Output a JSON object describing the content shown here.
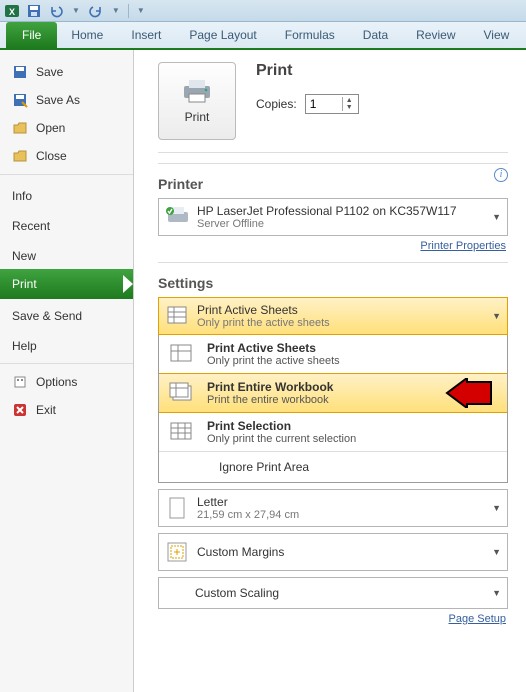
{
  "qat": {
    "undo_title": "Undo",
    "redo_title": "Redo"
  },
  "ribbon": {
    "file": "File",
    "tabs": [
      "Home",
      "Insert",
      "Page Layout",
      "Formulas",
      "Data",
      "Review",
      "View"
    ]
  },
  "sidebar": {
    "items": [
      {
        "label": "Save"
      },
      {
        "label": "Save As"
      },
      {
        "label": "Open"
      },
      {
        "label": "Close"
      }
    ],
    "cats": [
      {
        "label": "Info"
      },
      {
        "label": "Recent"
      },
      {
        "label": "New"
      },
      {
        "label": "Print"
      },
      {
        "label": "Save & Send"
      },
      {
        "label": "Help"
      }
    ],
    "footer": [
      {
        "label": "Options"
      },
      {
        "label": "Exit"
      }
    ]
  },
  "print": {
    "title": "Print",
    "button_label": "Print",
    "copies_label": "Copies:",
    "copies_value": "1"
  },
  "printer": {
    "section": "Printer",
    "name": "HP LaserJet Professional P1102 on KC357W117",
    "status": "Server Offline",
    "props_link": "Printer Properties"
  },
  "settings": {
    "section": "Settings",
    "selected": {
      "title": "Print Active Sheets",
      "sub": "Only print the active sheets"
    },
    "options": [
      {
        "title": "Print Active Sheets",
        "sub": "Only print the active sheets"
      },
      {
        "title": "Print Entire Workbook",
        "sub": "Print the entire workbook"
      },
      {
        "title": "Print Selection",
        "sub": "Only print the current selection"
      }
    ],
    "ignore": "Ignore Print Area",
    "paper": {
      "title": "Letter",
      "sub": "21,59 cm x 27,94 cm"
    },
    "margins": {
      "title": "Custom Margins"
    },
    "scaling": {
      "title": "Custom Scaling"
    },
    "page_setup": "Page Setup"
  }
}
